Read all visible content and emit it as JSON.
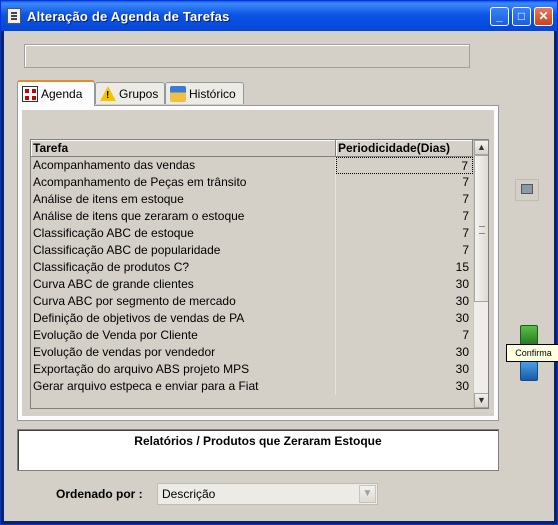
{
  "window": {
    "title": "Alteração de Agenda de Tarefas",
    "controls": {
      "minimize": "_",
      "maximize": "□",
      "close": "✕"
    }
  },
  "tabs": [
    {
      "label": "Agenda",
      "icon": "calendar-icon",
      "active": true
    },
    {
      "label": "Grupos",
      "icon": "warning-icon",
      "active": false
    },
    {
      "label": "Histórico",
      "icon": "history-icon",
      "active": false
    }
  ],
  "table": {
    "columns": [
      "Tarefa",
      "Periodicidade(Dias)"
    ],
    "rows": [
      [
        "Acompanhamento das vendas",
        "7"
      ],
      [
        "Acompanhamento de Peças em trânsito",
        "7"
      ],
      [
        "Análise de itens em estoque",
        "7"
      ],
      [
        "Análise de itens que zeraram o estoque",
        "7"
      ],
      [
        "Classificação ABC de estoque",
        "7"
      ],
      [
        "Classificação ABC de popularidade",
        "7"
      ],
      [
        "Classificação de produtos C?",
        "15"
      ],
      [
        "Curva ABC de grande clientes",
        "30"
      ],
      [
        "Curva ABC por segmento de mercado",
        "30"
      ],
      [
        "Definição de objetivos de vendas de PA",
        "30"
      ],
      [
        "Evolução de Venda por Cliente",
        "7"
      ],
      [
        "Evolução de vendas por vendedor",
        "30"
      ],
      [
        "Exportação do arquivo ABS projeto MPS",
        "30"
      ],
      [
        "Gerar arquivo estpeca e enviar para a Fiat",
        "30"
      ]
    ]
  },
  "tooltip": "Confirma",
  "info": {
    "text": "Relatórios / Produtos que Zeraram Estoque"
  },
  "order": {
    "label": "Ordenado por :",
    "value": "Descrição"
  },
  "colors": {
    "titlebar": "#0b55e6",
    "tab_highlight": "#e68b2c",
    "face": "#d4d0c8"
  }
}
